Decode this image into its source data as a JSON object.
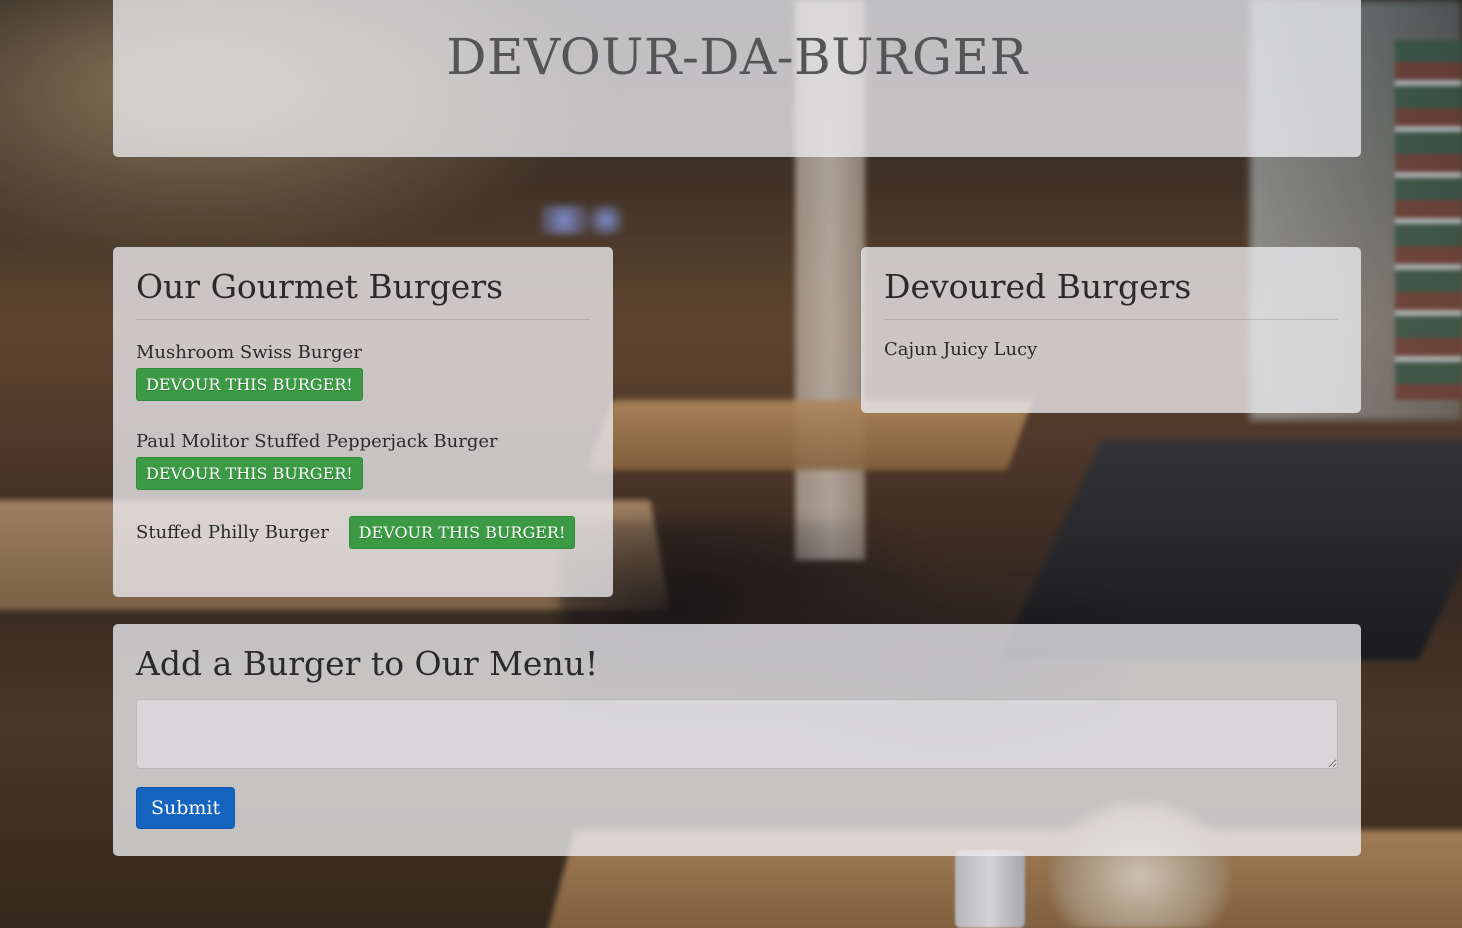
{
  "header": {
    "title": "DEVOUR-DA-BURGER"
  },
  "menu": {
    "title": "Our Gourmet Burgers",
    "devour_label": "DEVOUR THIS BURGER!",
    "burgers": [
      {
        "name": "Mushroom Swiss Burger"
      },
      {
        "name": "Paul Molitor Stuffed Pepperjack Burger"
      },
      {
        "name": "Stuffed Philly Burger"
      }
    ]
  },
  "devoured": {
    "title": "Devoured Burgers",
    "burgers": [
      {
        "name": "Cajun Juicy Lucy"
      }
    ]
  },
  "add_form": {
    "title": "Add a Burger to Our Menu!",
    "input_value": "",
    "submit_label": "Submit"
  },
  "colors": {
    "devour_button": "#3c9a45",
    "submit_button": "#1565c0",
    "panel": "#ececf0"
  }
}
